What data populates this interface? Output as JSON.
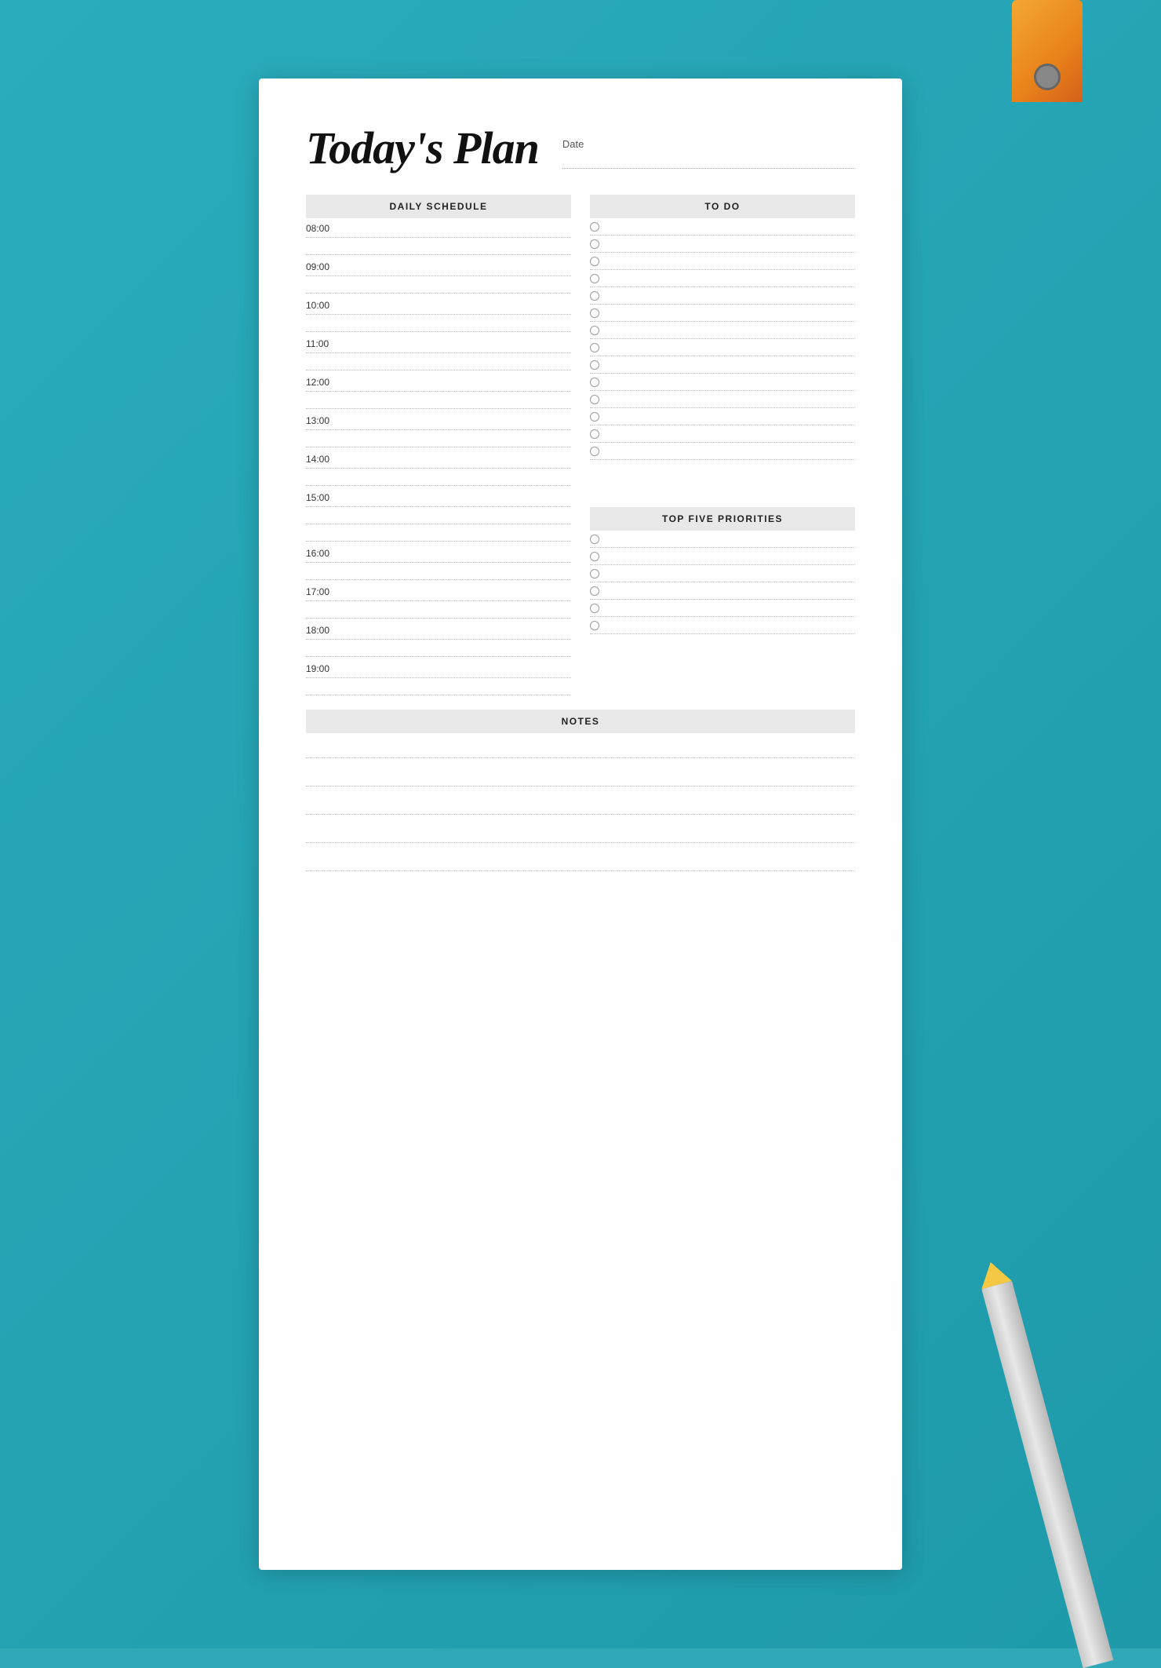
{
  "page": {
    "title": "Today's Plan",
    "date_label": "Date",
    "background_color": "#2aacbc"
  },
  "daily_schedule": {
    "header": "DAILY SCHEDULE",
    "time_slots": [
      "08:00",
      "09:00",
      "10:00",
      "11:00",
      "12:00",
      "13:00",
      "14:00",
      "15:00",
      "16:00",
      "17:00",
      "18:00",
      "19:00"
    ]
  },
  "todo": {
    "header": "TO DO",
    "items_count": 14
  },
  "top_five_priorities": {
    "header": "TOP FIVE PRIORITIES",
    "items_count": 6
  },
  "notes": {
    "header": "NOTES",
    "lines_count": 5
  }
}
